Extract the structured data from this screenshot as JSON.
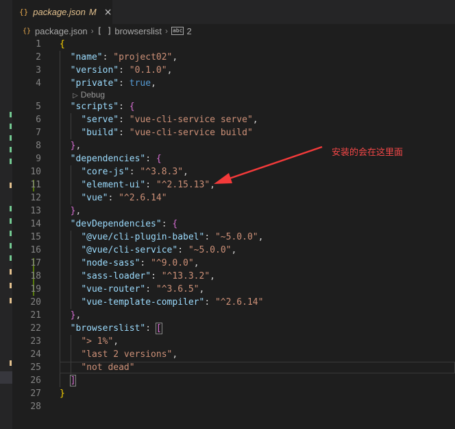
{
  "colors": {
    "editor_bg": "#1e1e1e",
    "annotation": "#f44747",
    "git_added": "#587c0c"
  },
  "tab": {
    "icon": "json-braces-icon",
    "icon_text": "{}",
    "title": "package.json",
    "badge": "M",
    "close": "×"
  },
  "breadcrumb": {
    "file": "package.json",
    "array_icon_text": "[ ]",
    "key": "browserslist",
    "abc_icon_text": "abc",
    "index": "2",
    "sep": "›"
  },
  "codelens": {
    "label": "Debug",
    "icon": "play-icon"
  },
  "annotation": {
    "text": "安装的会在这里面"
  },
  "lines": [
    {
      "n": "1"
    },
    {
      "n": "2"
    },
    {
      "n": "3"
    },
    {
      "n": "4"
    },
    {
      "n": "5"
    },
    {
      "n": "6"
    },
    {
      "n": "7"
    },
    {
      "n": "8"
    },
    {
      "n": "9"
    },
    {
      "n": "10"
    },
    {
      "n": "11"
    },
    {
      "n": "12"
    },
    {
      "n": "13"
    },
    {
      "n": "14"
    },
    {
      "n": "15"
    },
    {
      "n": "16"
    },
    {
      "n": "17"
    },
    {
      "n": "18"
    },
    {
      "n": "19"
    },
    {
      "n": "20"
    },
    {
      "n": "21"
    },
    {
      "n": "22"
    },
    {
      "n": "23"
    },
    {
      "n": "24"
    },
    {
      "n": "25"
    },
    {
      "n": "26"
    },
    {
      "n": "27"
    },
    {
      "n": "28"
    }
  ],
  "code": {
    "name_key": "\"name\"",
    "name_val": "\"project02\"",
    "version_key": "\"version\"",
    "version_val": "\"0.1.0\"",
    "private_key": "\"private\"",
    "private_val": "true",
    "scripts_key": "\"scripts\"",
    "serve_key": "\"serve\"",
    "serve_val": "\"vue-cli-service serve\"",
    "build_key": "\"build\"",
    "build_val": "\"vue-cli-service build\"",
    "deps_key": "\"dependencies\"",
    "corejs_key": "\"core-js\"",
    "corejs_val": "\"^3.8.3\"",
    "elementui_key": "\"element-ui\"",
    "elementui_val": "\"^2.15.13\"",
    "vue_key": "\"vue\"",
    "vue_val": "\"^2.6.14\"",
    "devdeps_key": "\"devDependencies\"",
    "babel_key": "\"@vue/cli-plugin-babel\"",
    "babel_val": "\"~5.0.0\"",
    "cliservice_key": "\"@vue/cli-service\"",
    "cliservice_val": "\"~5.0.0\"",
    "nodesass_key": "\"node-sass\"",
    "nodesass_val": "\"^9.0.0\"",
    "sassloader_key": "\"sass-loader\"",
    "sassloader_val": "\"^13.3.2\"",
    "vuerouter_key": "\"vue-router\"",
    "vuerouter_val": "\"^3.6.5\"",
    "vtc_key": "\"vue-template-compiler\"",
    "vtc_val": "\"^2.6.14\"",
    "browserslist_key": "\"browserslist\"",
    "bl_1": "\"> 1%\"",
    "bl_2": "\"last 2 versions\"",
    "bl_3": "\"not dead\""
  }
}
